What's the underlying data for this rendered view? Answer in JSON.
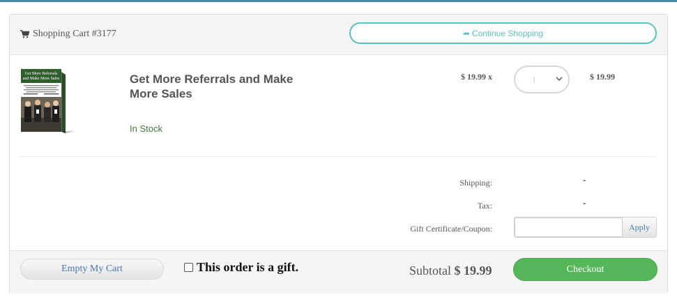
{
  "header": {
    "cart_title": "Shopping Cart #3177",
    "cart_icon": "shopping-cart-icon",
    "continue_label": "Continue Shopping",
    "continue_icon": "share-arrow-icon"
  },
  "item": {
    "title": "Get More Referrals and Make More Sales",
    "cover_lines": [
      "Get More Referrals",
      "and Make More Sales"
    ],
    "stock": "In Stock",
    "unit_price": "$ 19.99 x",
    "quantity": "1",
    "line_total": "$ 19.99"
  },
  "summary": {
    "shipping_label": "Shipping:",
    "shipping_value": "-",
    "tax_label": "Tax:",
    "tax_value": "-",
    "coupon_label": "Gift Certificate/Coupon:",
    "coupon_value": "",
    "apply_label": "Apply"
  },
  "footer": {
    "empty_label": "Empty My Cart",
    "gift_label": "This order is a gift.",
    "gift_checked": false,
    "subtotal_label": "Subtotal",
    "subtotal_amount": "$ 19.99",
    "checkout_label": "Checkout"
  },
  "colors": {
    "accent_teal": "#5bc0c0",
    "checkout_green": "#55b65a",
    "stock_green": "#3c7a3c",
    "link_blue": "#4a78b0"
  }
}
